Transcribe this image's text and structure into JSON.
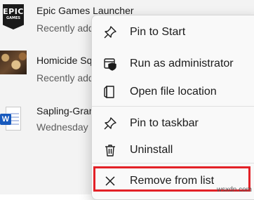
{
  "recent_items": [
    {
      "name": "Epic Games Launcher",
      "subtitle": "Recently added",
      "icon": "epic-games-icon",
      "logo_text_big": "EPIC",
      "logo_text_small": "GAMES"
    },
    {
      "name": "Homicide Squad",
      "subtitle": "Recently added",
      "icon": "game-thumbnail-icon"
    },
    {
      "name": "Sapling-Grant",
      "subtitle": "Wednesday",
      "icon": "word-document-icon",
      "badge": "W"
    }
  ],
  "context_menu": {
    "items": [
      {
        "label": "Pin to Start",
        "icon": "pin-icon"
      },
      {
        "label": "Run as administrator",
        "icon": "shield-icon"
      },
      {
        "label": "Open file location",
        "icon": "folder-icon"
      },
      {
        "label": "Pin to taskbar",
        "icon": "pin-icon"
      },
      {
        "label": "Uninstall",
        "icon": "trash-icon"
      },
      {
        "label": "Remove from list",
        "icon": "close-icon"
      }
    ]
  },
  "highlight_color": "#e32127",
  "watermark": "wsxdn.com"
}
